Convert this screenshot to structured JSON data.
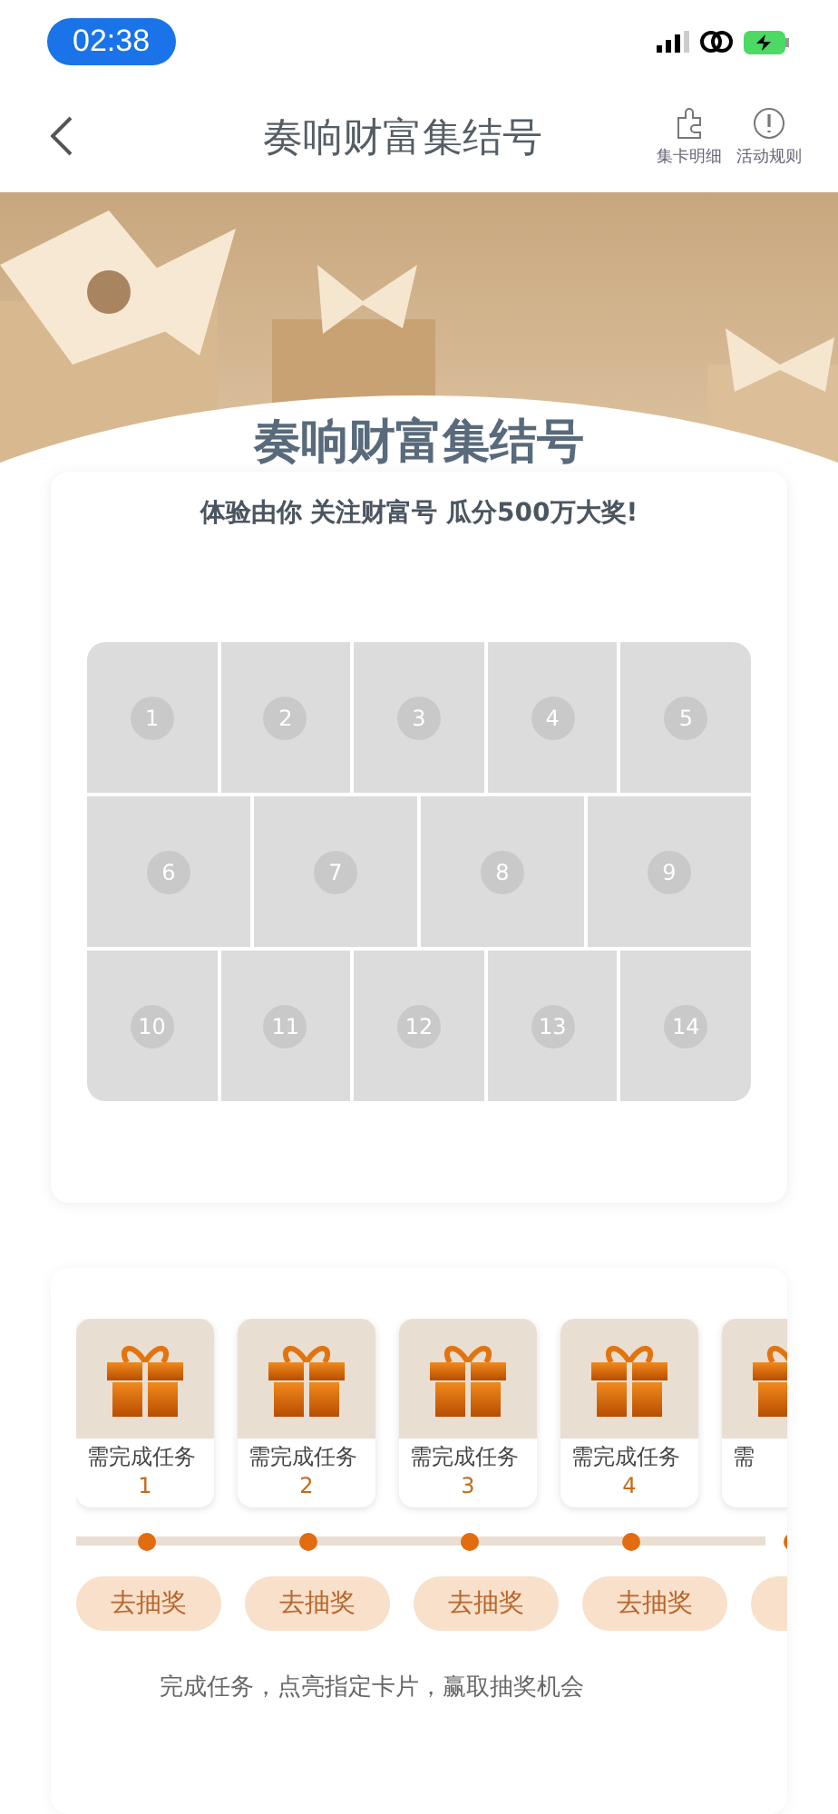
{
  "status_bar": {
    "time": "02:38"
  },
  "nav": {
    "title": "奏响财富集结号",
    "actions": [
      {
        "kind": "puzzle",
        "label": "集卡明细"
      },
      {
        "kind": "info",
        "label": "活动规则"
      }
    ]
  },
  "banner": {
    "title": "奏响财富集结号"
  },
  "puzzle": {
    "subtitle": "体验由你 关注财富号 瓜分500万大奖!",
    "rows": [
      [
        "1",
        "2",
        "3",
        "4",
        "5"
      ],
      [
        "6",
        "7",
        "8",
        "9"
      ],
      [
        "10",
        "11",
        "12",
        "13",
        "14"
      ]
    ]
  },
  "tasks": {
    "items": [
      {
        "label": "需完成任务",
        "number": "1",
        "button": "去抽奖",
        "disabled": true
      },
      {
        "label": "需完成任务",
        "number": "2",
        "button": "去抽奖",
        "disabled": true
      },
      {
        "label": "需完成任务",
        "number": "3",
        "button": "去抽奖",
        "disabled": true
      },
      {
        "label": "需完成任务",
        "number": "4",
        "button": "去抽奖",
        "disabled": true
      },
      {
        "label": "需",
        "disabled": true
      }
    ],
    "note": "完成任务，点亮指定卡片，赢取抽奖机会"
  }
}
